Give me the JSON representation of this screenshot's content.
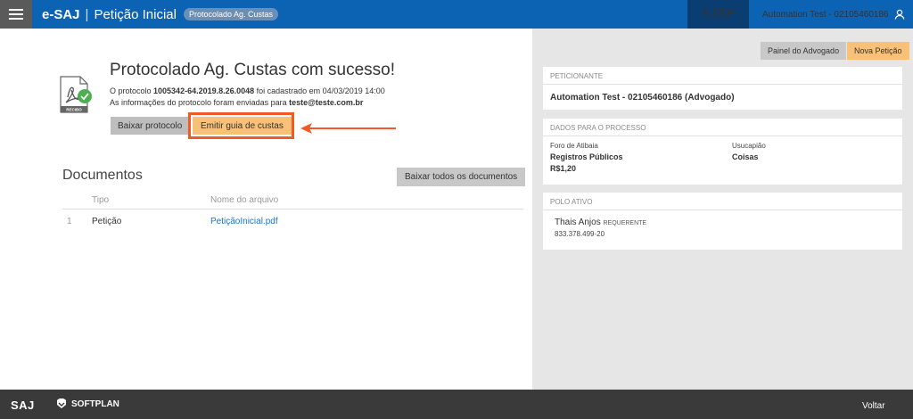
{
  "header": {
    "brand": "e-SAJ",
    "separator": "|",
    "title": "Petição Inicial",
    "status_badge": "Protocolado Ag. Custas",
    "court": "TJSP",
    "user": "Automation Test - 02105460186",
    "colors": {
      "bar": "#0d63b3",
      "court_bg": "#0a3e73"
    }
  },
  "main": {
    "success_title": "Protocolado Ag. Custas com sucesso!",
    "protocol_prefix": "O protocolo ",
    "protocol_number": "1005342-64.2019.8.26.0048",
    "protocol_suffix": " foi cadastrado em 04/03/2019 14:00",
    "email_prefix": "As informações do protocolo foram enviadas para ",
    "email": "teste@teste.com.br",
    "icon_caption": "RECIBO",
    "buttons": {
      "download_protocol": "Baixar protocolo",
      "emit_guide": "Emitir guia de custas"
    }
  },
  "documents": {
    "title": "Documentos",
    "download_all": "Baixar todos os documentos",
    "columns": {
      "type": "Tipo",
      "filename": "Nome do arquivo"
    },
    "rows": [
      {
        "index": "1",
        "type": "Petição",
        "file": "PetiçãoInicial.pdf"
      }
    ]
  },
  "side": {
    "painel_btn": "Painel do Advogado",
    "nova_btn": "Nova Petição",
    "peticionante_head": "PETICIONANTE",
    "peticionante": "Automation Test - 02105460186 (Advogado)",
    "processo_head": "DADOS PARA O PROCESSO",
    "foro": "Foro de Atibaia",
    "competencia": "Registros Públicos",
    "valor": "R$1,20",
    "classe": "Usucapião",
    "assunto": "Coisas",
    "polo_head": "POLO ATIVO",
    "parte_nome": "Thais Anjos",
    "parte_tipo": "REQUERENTE",
    "parte_doc": "833.378.499-20"
  },
  "footer": {
    "saj": "SAJ",
    "softplan": "SOFTPLAN",
    "voltar": "Voltar"
  }
}
